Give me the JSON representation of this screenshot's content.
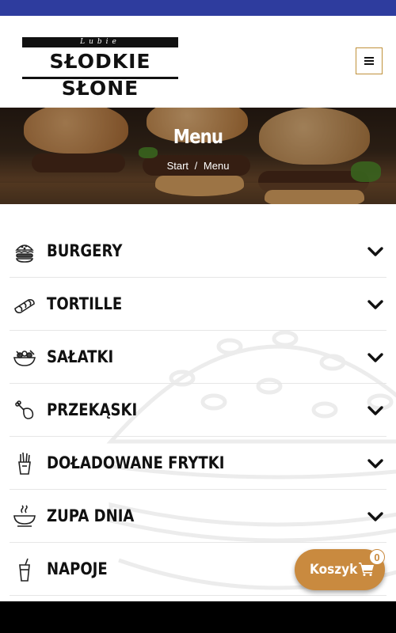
{
  "brand": {
    "tagline": "Lubie",
    "name": "SŁODKIE SŁONE",
    "accent_color": "#c0913b",
    "top_bar_color": "#2e3c9e"
  },
  "header": {
    "menu_icon": "hamburger-icon"
  },
  "hero": {
    "title": "Menu",
    "breadcrumb": {
      "home": "Start",
      "separator": "/",
      "current": "Menu"
    }
  },
  "categories": [
    {
      "label": "BURGERY",
      "icon": "burger-icon",
      "expand_icon": "chevron-down-icon"
    },
    {
      "label": "TORTILLE",
      "icon": "tortilla-icon",
      "expand_icon": "chevron-down-icon"
    },
    {
      "label": "SAŁATKI",
      "icon": "salad-icon",
      "expand_icon": "chevron-down-icon"
    },
    {
      "label": "PRZEKĄSKI",
      "icon": "drumstick-icon",
      "expand_icon": "chevron-down-icon"
    },
    {
      "label": "DOŁADOWANE FRYTKI",
      "icon": "fries-icon",
      "expand_icon": "chevron-down-icon"
    },
    {
      "label": "ZUPA DNIA",
      "icon": "soup-icon",
      "expand_icon": "chevron-down-icon"
    },
    {
      "label": "NAPOJE",
      "icon": "drink-icon",
      "expand_icon": "chevron-down-icon"
    }
  ],
  "cart": {
    "label": "Koszyk",
    "icon": "cart-icon",
    "count": "0",
    "color": "#c98a3f"
  }
}
